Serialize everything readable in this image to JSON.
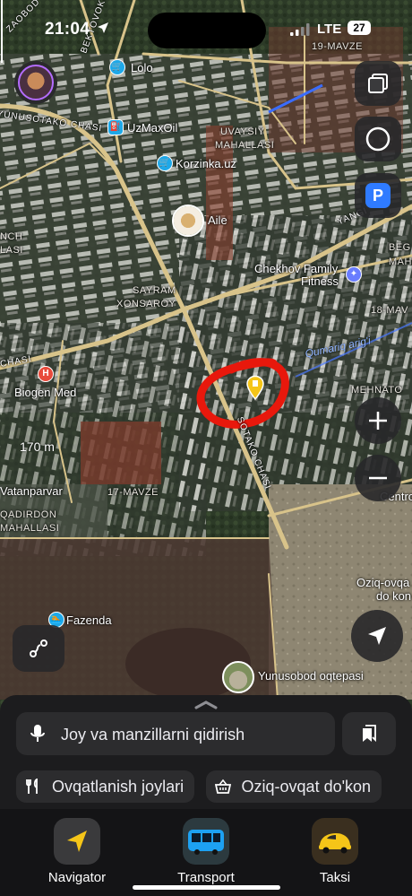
{
  "status": {
    "time": "21:04",
    "network": "LTE",
    "battery": "27"
  },
  "map": {
    "street_labels": [
      "YUNUSOTAKO CHASI",
      "BEKTOVOKO",
      "SOTAKO CHASI",
      "YANGI",
      "ZAOBOD",
      "CHASI"
    ],
    "area_labels": [
      "UVAYSIY",
      "MAHALLASI",
      "SAYRAM",
      "XONSAROY",
      "17-MAVZE",
      "QADIRDON",
      "MAHALLASI",
      "19-MAVZE",
      "18-MAV",
      "MEHNATO",
      "BEG",
      "MAH",
      "NCH",
      "LASI"
    ],
    "pois": [
      "Lolo",
      "UzMaxOil",
      "Korzinka.uz",
      "Aile",
      "Chekhov Family",
      "Fitness",
      "Biogen Med",
      "Vatanparvar",
      "Fazenda",
      "Yunusobod oqtepasi",
      "Oziq-ovqa",
      "do kon",
      "Centro"
    ],
    "water": "Qumariq arig'i",
    "scale": "170 m",
    "marker_highlight_color": "#e8180c",
    "marker_color": "#f5c518"
  },
  "controls": [
    "layers-icon",
    "traffic-icon",
    "parking-icon",
    "zoom-in-icon",
    "zoom-out-icon",
    "route-icon",
    "locate-icon"
  ],
  "parking_label": "P",
  "search": {
    "placeholder": "Joy va manzillarni qidirish"
  },
  "categories": [
    {
      "label": "Ovqatlanish joylari",
      "icon": "fork-knife-icon"
    },
    {
      "label": "Oziq-ovqat do'kon",
      "icon": "basket-icon"
    }
  ],
  "tabs": [
    {
      "label": "Navigator",
      "icon": "navigator-arrow-icon"
    },
    {
      "label": "Transport",
      "icon": "bus-icon"
    },
    {
      "label": "Taksi",
      "icon": "taxi-icon"
    }
  ]
}
